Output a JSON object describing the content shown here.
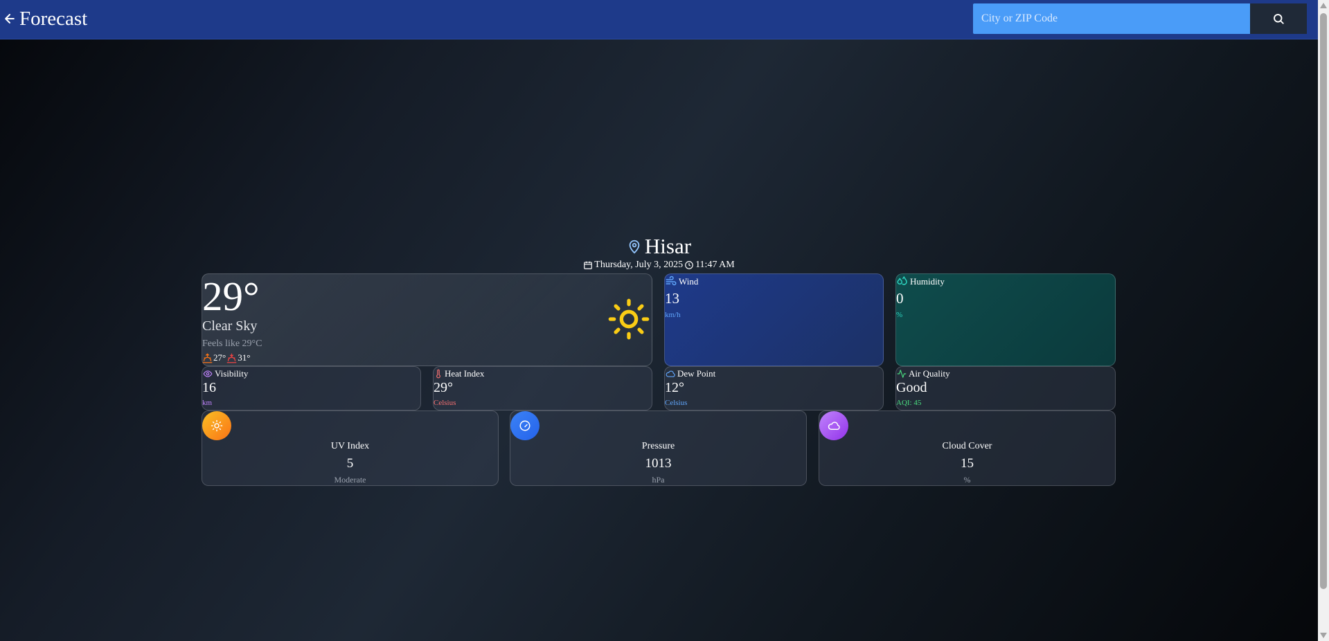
{
  "header": {
    "title": "Forecast",
    "search_placeholder": "City or ZIP Code"
  },
  "location": {
    "city": "Hisar",
    "date": "Thursday, July 3, 2025",
    "time": "11:47 AM"
  },
  "current": {
    "temp": "29°",
    "condition": "Clear Sky",
    "feels_like": "Feels like 29°C",
    "min": "27°",
    "max": "31°"
  },
  "wind": {
    "label": "Wind",
    "value": "13",
    "unit": "km/h"
  },
  "humidity": {
    "label": "Humidity",
    "value": "0",
    "unit": "%"
  },
  "visibility": {
    "label": "Visibility",
    "value": "16",
    "unit": "km"
  },
  "heat_index": {
    "label": "Heat Index",
    "value": "29°",
    "unit": "Celsius"
  },
  "dew_point": {
    "label": "Dew Point",
    "value": "12°",
    "unit": "Celsius"
  },
  "air_quality": {
    "label": "Air Quality",
    "value": "Good",
    "unit": "AQI: 45"
  },
  "uv": {
    "label": "UV Index",
    "value": "5",
    "sub": "Moderate"
  },
  "pressure": {
    "label": "Pressure",
    "value": "1013",
    "sub": "hPa"
  },
  "cloud_cover": {
    "label": "Cloud Cover",
    "value": "15",
    "sub": "%"
  },
  "colors": {
    "header": "#1e3a8a",
    "search": "#4a9cf8",
    "sun": "#facc15",
    "wind_unit": "#60a5fa",
    "humidity_unit": "#2dd4bf",
    "visibility_unit": "#c084fc",
    "heat_unit": "#f87171",
    "dew_unit": "#60a5fa",
    "aqi_unit": "#4ade80",
    "uv_circle": "#f59e0b",
    "pressure_circle": "#3b82f6",
    "cloud_circle": "#a855f7"
  },
  "icons": [
    "arrow-left-icon",
    "search-icon",
    "map-pin-icon",
    "calendar-icon",
    "clock-icon",
    "sun-icon",
    "sunrise-icon",
    "sunset-icon",
    "wind-icon",
    "droplets-icon",
    "eye-icon",
    "thermometer-icon",
    "cloud-icon",
    "activity-icon",
    "gauge-icon"
  ]
}
